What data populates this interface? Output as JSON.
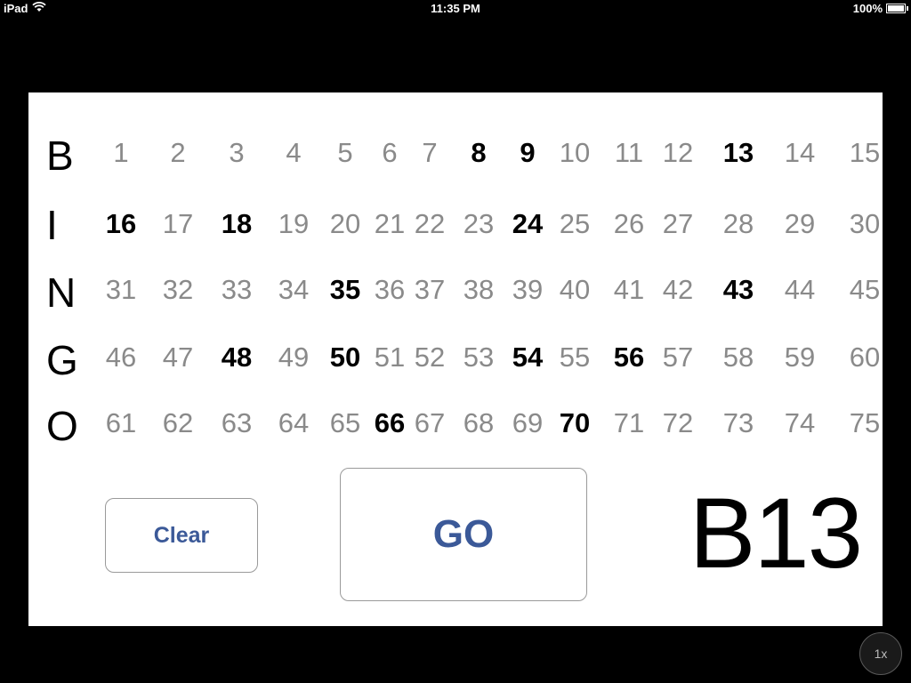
{
  "status_bar": {
    "device": "iPad",
    "time": "11:35 PM",
    "battery": "100%"
  },
  "board": {
    "rows": [
      {
        "letter": "B",
        "numbers": [
          1,
          2,
          3,
          4,
          5,
          6,
          7,
          8,
          9,
          10,
          11,
          12,
          13,
          14,
          15
        ]
      },
      {
        "letter": "I",
        "numbers": [
          16,
          17,
          18,
          19,
          20,
          21,
          22,
          23,
          24,
          25,
          26,
          27,
          28,
          29,
          30
        ]
      },
      {
        "letter": "N",
        "numbers": [
          31,
          32,
          33,
          34,
          35,
          36,
          37,
          38,
          39,
          40,
          41,
          42,
          43,
          44,
          45
        ]
      },
      {
        "letter": "G",
        "numbers": [
          46,
          47,
          48,
          49,
          50,
          51,
          52,
          53,
          54,
          55,
          56,
          57,
          58,
          59,
          60
        ]
      },
      {
        "letter": "O",
        "numbers": [
          61,
          62,
          63,
          64,
          65,
          66,
          67,
          68,
          69,
          70,
          71,
          72,
          73,
          74,
          75
        ]
      }
    ],
    "called": [
      8,
      9,
      13,
      16,
      18,
      24,
      35,
      43,
      48,
      50,
      54,
      56,
      66,
      70
    ]
  },
  "controls": {
    "clear_label": "Clear",
    "go_label": "GO"
  },
  "current_call": "B13",
  "zoom_label": "1x",
  "colors": {
    "called": "#000000",
    "uncalled": "#8a8a8a",
    "button_text": "#3b5998"
  }
}
